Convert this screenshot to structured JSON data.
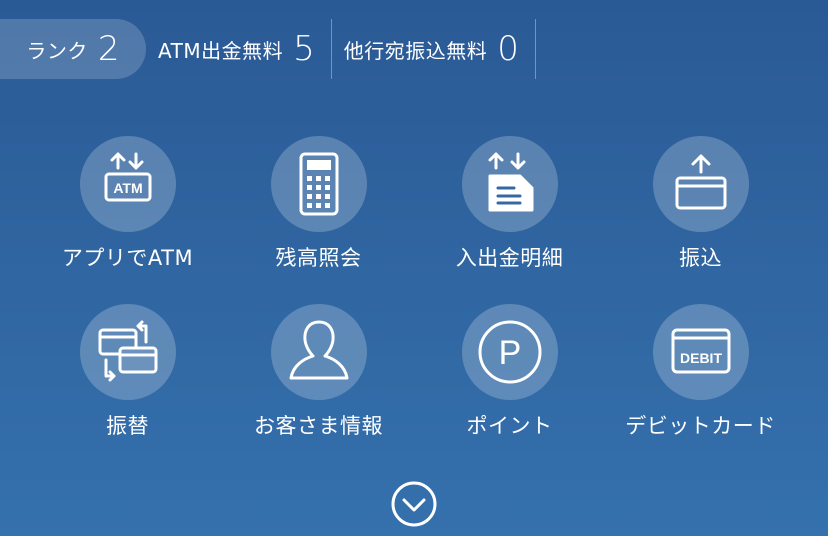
{
  "stats": {
    "rank": {
      "label": "ランク",
      "value": "2"
    },
    "atm": {
      "label": "ATM出金無料",
      "value": "5"
    },
    "transfer": {
      "label": "他行宛振込無料",
      "value": "0"
    }
  },
  "menu": {
    "items": [
      {
        "label": "アプリでATM",
        "icon": "atm-icon",
        "icon_text": "ATM"
      },
      {
        "label": "残高照会",
        "icon": "calculator-icon"
      },
      {
        "label": "入出金明細",
        "icon": "statement-icon"
      },
      {
        "label": "振込",
        "icon": "card-transfer-icon"
      },
      {
        "label": "振替",
        "icon": "card-swap-icon"
      },
      {
        "label": "お客さま情報",
        "icon": "person-icon"
      },
      {
        "label": "ポイント",
        "icon": "point-icon",
        "icon_text": "P"
      },
      {
        "label": "デビットカード",
        "icon": "debit-card-icon",
        "icon_text": "DEBIT"
      }
    ]
  },
  "expand_icon": "chevron-down-circle-icon",
  "colors": {
    "background_top": "#2a5a95",
    "background_bottom": "#3571ad",
    "icon_fg": "#ffffff"
  }
}
